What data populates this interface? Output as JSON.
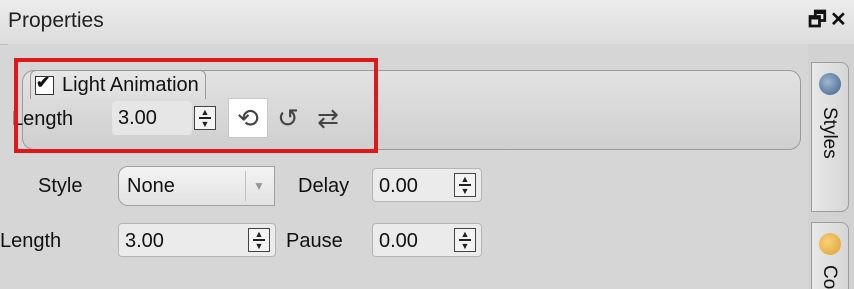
{
  "panel": {
    "title": "Properties",
    "float_glyph": "🗗",
    "close_glyph": "✕"
  },
  "light_animation": {
    "checkbox_label": "Light Animation",
    "checked": true,
    "length_label": "Length",
    "length_value": "3.00",
    "tools": [
      {
        "icon": "loop-off-icon",
        "glyph": "⟲",
        "active": true
      },
      {
        "icon": "ping-pong-icon",
        "glyph": "↺",
        "active": false
      },
      {
        "icon": "repeat-icon",
        "glyph": "⇄",
        "active": false
      }
    ]
  },
  "style_row": {
    "style_label": "Style",
    "style_value": "None",
    "delay_label": "Delay",
    "delay_value": "0.00"
  },
  "length_row": {
    "length_label": "Length",
    "length_value": "3.00",
    "pause_label": "Pause",
    "pause_value": "0.00"
  },
  "side_tabs": [
    {
      "label": "Styles",
      "icon": "styles-icon",
      "icon_color": "#3a5f8a"
    },
    {
      "label": "Co",
      "icon": "color-palette-icon",
      "icon_color": "#e0a030"
    }
  ],
  "colors": {
    "highlight": "#e01818"
  }
}
